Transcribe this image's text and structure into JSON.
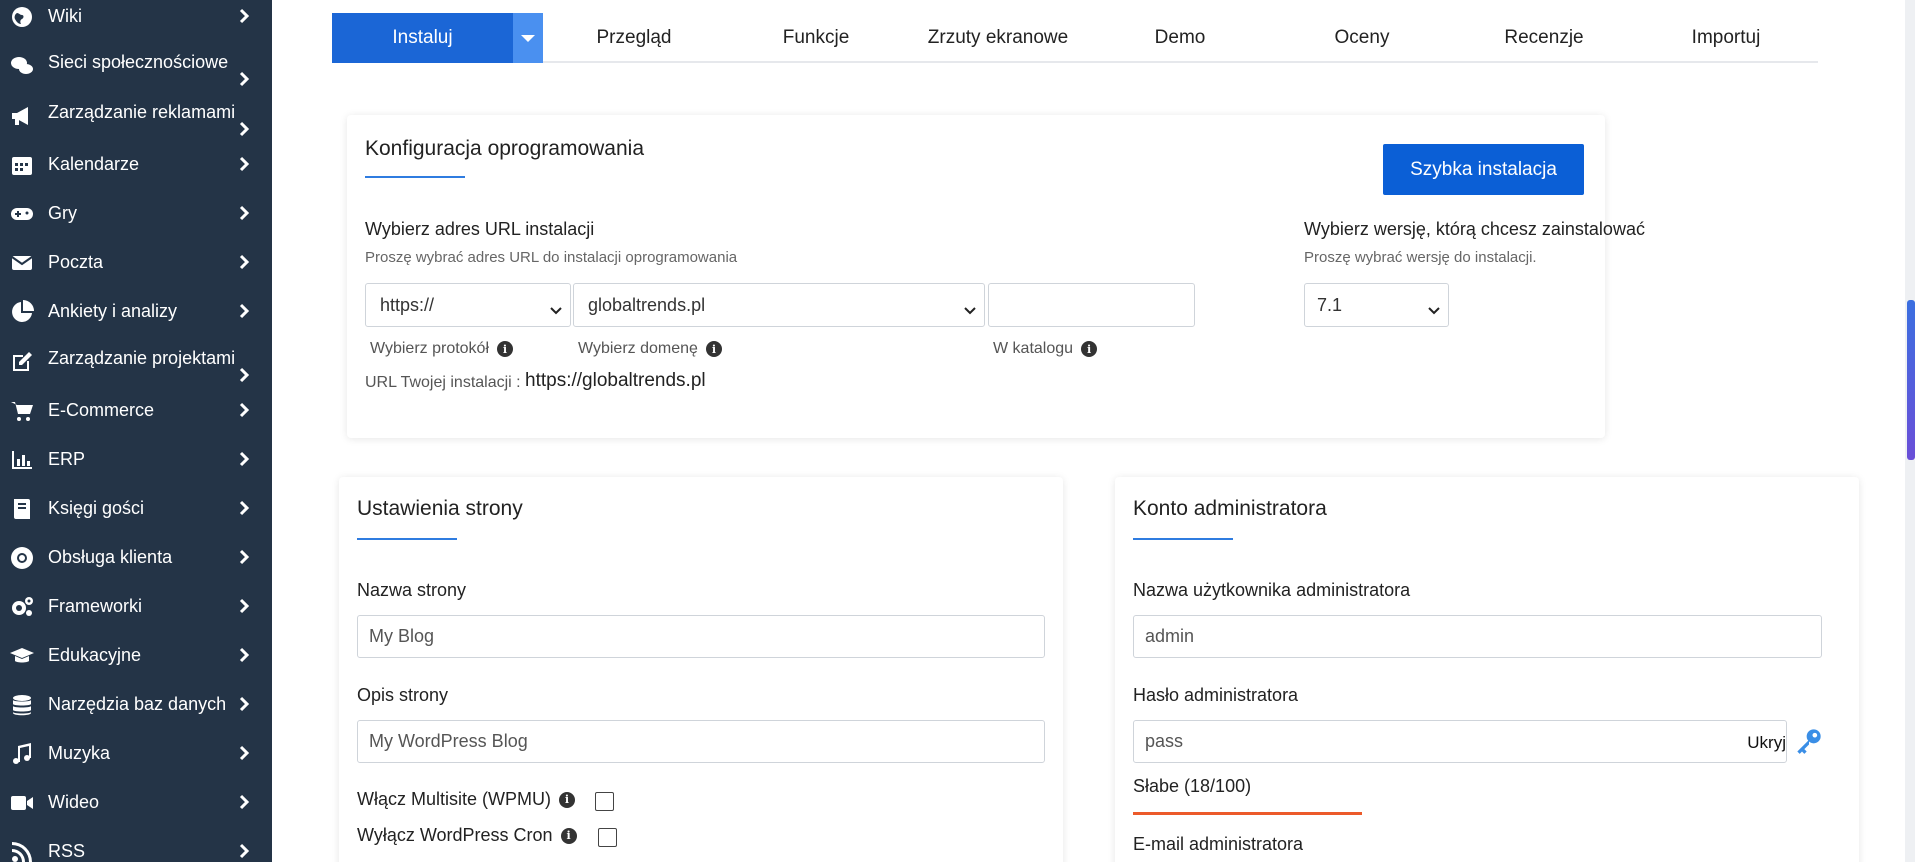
{
  "sidebar": {
    "items": [
      {
        "label": "Wiki",
        "icon": "globe-icon"
      },
      {
        "label": "Sieci społecznościowe",
        "icon": "chat-icon"
      },
      {
        "label": "Zarządzanie reklamami",
        "icon": "megaphone-icon"
      },
      {
        "label": "Kalendarze",
        "icon": "calendar-icon"
      },
      {
        "label": "Gry",
        "icon": "gamepad-icon"
      },
      {
        "label": "Poczta",
        "icon": "envelope-icon"
      },
      {
        "label": "Ankiety i analizy",
        "icon": "pie-chart-icon"
      },
      {
        "label": "Zarządzanie projektami",
        "icon": "edit-icon"
      },
      {
        "label": "E-Commerce",
        "icon": "cart-icon"
      },
      {
        "label": "ERP",
        "icon": "bar-chart-icon"
      },
      {
        "label": "Księgi gości",
        "icon": "book-icon"
      },
      {
        "label": "Obsługa klienta",
        "icon": "lifebuoy-icon"
      },
      {
        "label": "Frameworki",
        "icon": "cogs-icon"
      },
      {
        "label": "Edukacyjne",
        "icon": "graduation-cap-icon"
      },
      {
        "label": "Narzędzia baz danych",
        "icon": "database-icon"
      },
      {
        "label": "Muzyka",
        "icon": "music-icon"
      },
      {
        "label": "Wideo",
        "icon": "video-icon"
      },
      {
        "label": "RSS",
        "icon": "rss-icon"
      }
    ]
  },
  "tabs": {
    "install": "Instaluj",
    "items": [
      "Przegląd",
      "Funkcje",
      "Zrzuty ekranowe",
      "Demo",
      "Oceny",
      "Recenzje",
      "Importuj"
    ]
  },
  "config": {
    "title": "Konfiguracja oprogramowania",
    "quick_install": "Szybka instalacja",
    "url_label": "Wybierz adres URL instalacji",
    "url_sub": "Proszę wybrać adres URL do instalacji oprogramowania",
    "protocol_value": "https://",
    "domain_value": "globaltrends.pl",
    "directory_value": "",
    "protocol_hint": "Wybierz protokół",
    "domain_hint": "Wybierz domenę",
    "directory_hint": "W katalogu",
    "your_url_label": "URL Twojej instalacji :",
    "your_url_value": "https://globaltrends.pl",
    "version_label": "Wybierz wersję, którą chcesz zainstalować",
    "version_sub": "Proszę wybrać wersję do instalacji.",
    "version_value": "7.1"
  },
  "site": {
    "title": "Ustawienia strony",
    "name_label": "Nazwa strony",
    "name_value": "My Blog",
    "desc_label": "Opis strony",
    "desc_value": "My WordPress Blog",
    "multisite_label": "Włącz Multisite (WPMU)",
    "cron_label": "Wyłącz WordPress Cron"
  },
  "admin": {
    "title": "Konto administratora",
    "username_label": "Nazwa użytkownika administratora",
    "username_value": "admin",
    "password_label": "Hasło administratora",
    "password_value": "pass",
    "hide_label": "Ukryj",
    "strength_label": "Słabe (18/100)",
    "strength_value": 18,
    "email_label": "E-mail administratora"
  },
  "colors": {
    "sidebar_bg": "#243447",
    "primary": "#1b66d6",
    "accent_underline": "#2f7ce0",
    "strength_weak": "#ec5a2a"
  }
}
